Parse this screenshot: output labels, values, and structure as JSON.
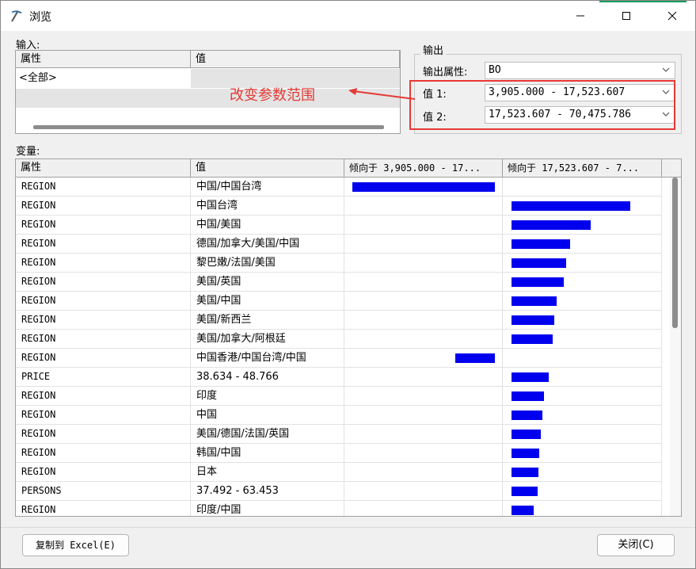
{
  "window": {
    "title": "浏览"
  },
  "input": {
    "label": "输入:",
    "columns": [
      "属性",
      "值"
    ],
    "rows": [
      {
        "attr": "<全部>"
      }
    ]
  },
  "output": {
    "legend": "输出",
    "attr_label": "输出属性:",
    "attr_value": "BO",
    "value1_label": "值 1:",
    "value1": "3,905.000 - 17,523.607",
    "value2_label": "值 2:",
    "value2": "17,523.607 - 70,475.786"
  },
  "annotation": {
    "text": "改变参数范围",
    "color": "#e53935"
  },
  "variables": {
    "label": "变量:",
    "columns": [
      "属性",
      "值",
      "倾向于 3,905.000 - 17...",
      "倾向于 17,523.607 - 7..."
    ],
    "bar_color": "#0000ee",
    "rows": [
      {
        "attr": "REGION",
        "value": "中国/中国台湾",
        "favors1": 180,
        "favors2": 0
      },
      {
        "attr": "REGION",
        "value": "中国台湾",
        "favors1": 0,
        "favors2": 150
      },
      {
        "attr": "REGION",
        "value": "中国/美国",
        "favors1": 0,
        "favors2": 100
      },
      {
        "attr": "REGION",
        "value": "德国/加拿大/美国/中国",
        "favors1": 0,
        "favors2": 74
      },
      {
        "attr": "REGION",
        "value": "黎巴嫩/法国/美国",
        "favors1": 0,
        "favors2": 69
      },
      {
        "attr": "REGION",
        "value": "美国/英国",
        "favors1": 0,
        "favors2": 66
      },
      {
        "attr": "REGION",
        "value": "美国/中国",
        "favors1": 0,
        "favors2": 57
      },
      {
        "attr": "REGION",
        "value": "美国/新西兰",
        "favors1": 0,
        "favors2": 54
      },
      {
        "attr": "REGION",
        "value": "美国/加拿大/阿根廷",
        "favors1": 0,
        "favors2": 52
      },
      {
        "attr": "REGION",
        "value": "中国香港/中国台湾/中国",
        "favors1": 50,
        "favors2": 0
      },
      {
        "attr": "PRICE",
        "value": "38.634 - 48.766",
        "favors1": 0,
        "favors2": 47
      },
      {
        "attr": "REGION",
        "value": "印度",
        "favors1": 0,
        "favors2": 41
      },
      {
        "attr": "REGION",
        "value": "中国",
        "favors1": 0,
        "favors2": 39
      },
      {
        "attr": "REGION",
        "value": "美国/德国/法国/英国",
        "favors1": 0,
        "favors2": 37
      },
      {
        "attr": "REGION",
        "value": "韩国/中国",
        "favors1": 0,
        "favors2": 35
      },
      {
        "attr": "REGION",
        "value": "日本",
        "favors1": 0,
        "favors2": 34
      },
      {
        "attr": "PERSONS",
        "value": "37.492 - 63.453",
        "favors1": 0,
        "favors2": 33
      },
      {
        "attr": "REGION",
        "value": "印度/中国",
        "favors1": 0,
        "favors2": 28
      }
    ]
  },
  "buttons": {
    "copy": "复制到 Excel(E)",
    "close": "关闭(C)"
  }
}
